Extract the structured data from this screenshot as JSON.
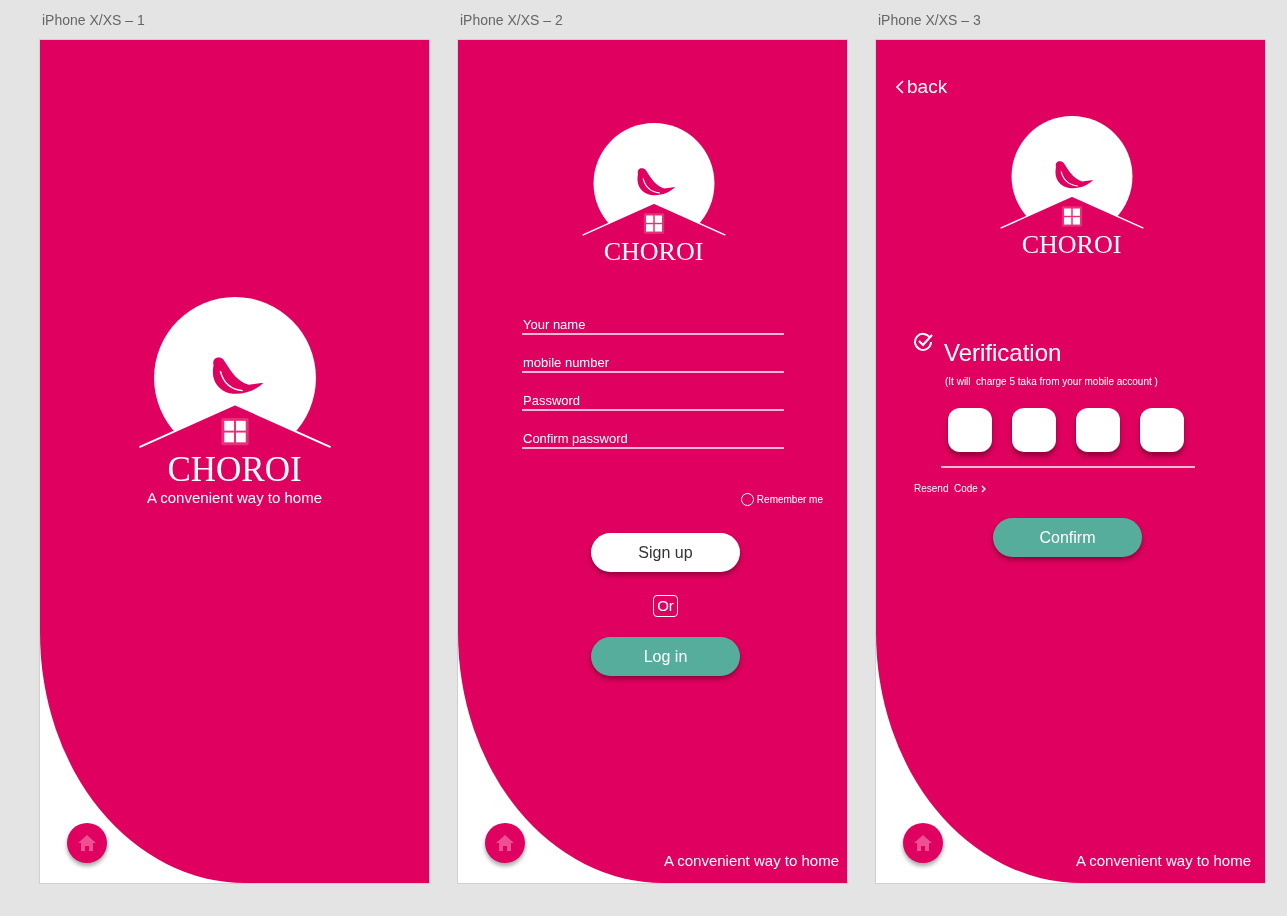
{
  "artboards": [
    {
      "kind": "splash",
      "label": "iPhone X/XS – 1",
      "logo": "CHOROI",
      "tagline": "A convenient way to home"
    },
    {
      "kind": "signup",
      "label": "iPhone X/XS – 2",
      "logo": "CHOROI",
      "fields": [
        {
          "placeholder": "Your name"
        },
        {
          "placeholder": "mobile number"
        },
        {
          "placeholder": "Password"
        },
        {
          "placeholder": "Confirm password"
        }
      ],
      "remember": {
        "label": "Remember me",
        "checked": false
      },
      "primary_button": "Sign up",
      "separator": "Or",
      "secondary_button": "Log in",
      "tagline": "A convenient way to home"
    },
    {
      "kind": "verify",
      "label": "iPhone X/XS – 3",
      "back": "back",
      "logo": "CHOROI",
      "title": "Verification",
      "note": "(It will  charge 5 taka from your mobile account )",
      "resend": "Resend  Code",
      "confirm_button": "Confirm",
      "tagline": "A convenient way to home"
    }
  ]
}
